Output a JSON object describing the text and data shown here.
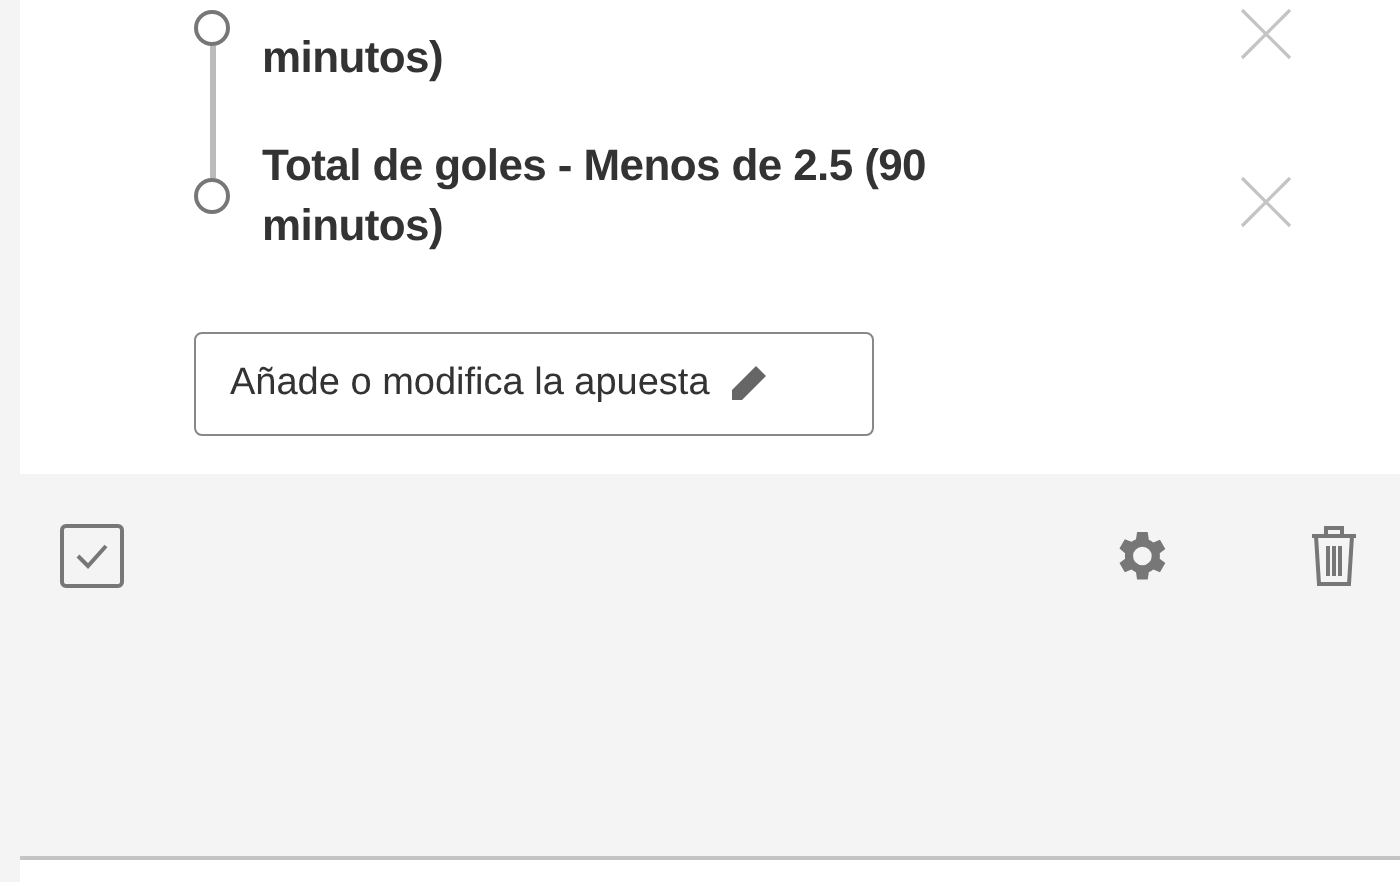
{
  "selections": [
    {
      "label": "minutos)"
    },
    {
      "label": "Total de goles - Menos de 2.5 (90 minutos)"
    }
  ],
  "edit_button": {
    "label": "Añade o modifica la apuesta"
  }
}
